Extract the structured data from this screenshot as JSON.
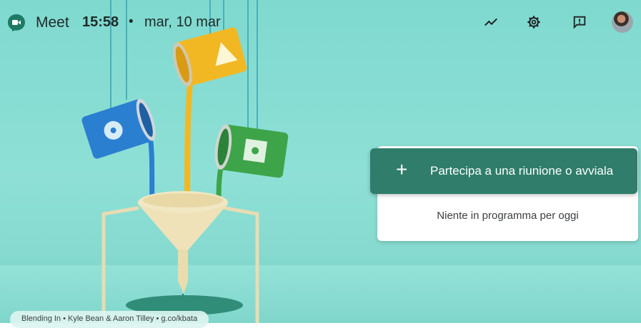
{
  "topbar": {
    "app_name": "Meet",
    "time": "15:58",
    "separator": "•",
    "date": "mar, 10 mar",
    "icons": [
      "trending-icon",
      "settings-icon",
      "feedback-icon",
      "avatar"
    ]
  },
  "meeting": {
    "join_icon": "+",
    "join_label": "Partecipa a una riunione o avviala",
    "empty_message": "Niente in programma per oggi"
  },
  "credit": {
    "text": "Blending In  •  Kyle Bean & Aaron Tilley  •  g.co/kbata"
  },
  "colors": {
    "background": "#86dacf",
    "join_button": "#2f7d6a",
    "card": "#ffffff",
    "paint_blue": "#2b7fd0",
    "paint_yellow": "#f2b824",
    "paint_green": "#3ea44a"
  }
}
